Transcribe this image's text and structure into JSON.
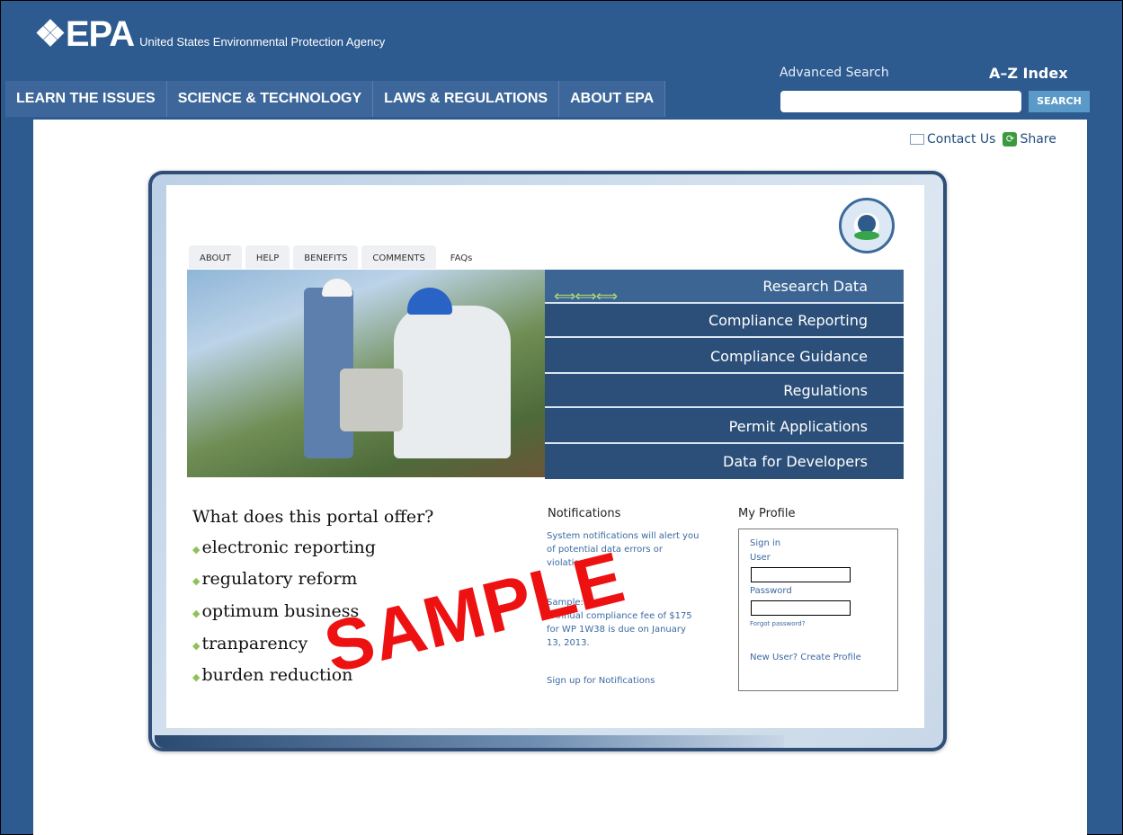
{
  "header": {
    "logo_mark": "❖EPA",
    "logo_sub": "United States Environmental Protection Agency",
    "advanced_search": "Advanced Search",
    "az_index": "A–Z Index",
    "search_placeholder": "",
    "search_label": "SEARCH",
    "nav": [
      "LEARN THE ISSUES",
      "SCIENCE & TECHNOLOGY",
      "LAWS & REGULATIONS",
      "ABOUT EPA"
    ]
  },
  "utility": {
    "contact": "Contact Us",
    "share": "Share"
  },
  "portal": {
    "tabs": [
      "ABOUT",
      "HELP",
      "BENEFITS",
      "COMMENTS",
      "FAQs"
    ],
    "menu": [
      "Research Data",
      "Compliance Reporting",
      "Compliance Guidance",
      "Regulations",
      "Permit Applications",
      "Data for Developers"
    ],
    "offer_title": "What does this portal offer?",
    "offers": [
      "electronic reporting",
      "regulatory reform",
      "optimum business",
      "tranparency",
      "burden reduction"
    ],
    "notifications": {
      "title": "Notifications",
      "text": "System notifications will alert you of potential data errors or violations.",
      "sample_label": "Sample:",
      "sample_text": "•Annual compliance fee of $175 for WP 1W38 is due on January 13, 2013.",
      "signup": "Sign up for Notifications"
    },
    "profile": {
      "title": "My Profile",
      "sign_in": "Sign in",
      "user": "User",
      "password": "Password",
      "forgot": "Forgot password?",
      "new_user": "New User? Create Profile"
    },
    "watermark": "SAMPLE"
  },
  "colors": {
    "header_bg": "#2d5a8f",
    "menu_bg": "#2b4f79",
    "accent_green": "#8fc158",
    "watermark": "#ee1111"
  }
}
